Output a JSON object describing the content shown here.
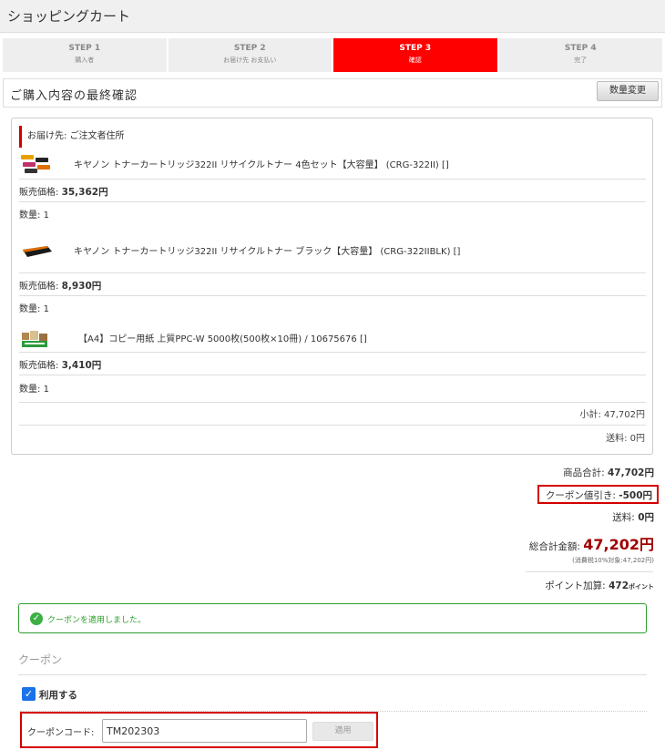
{
  "header": {
    "title": "ショッピングカート"
  },
  "steps": [
    {
      "num": "STEP 1",
      "label": "購入者"
    },
    {
      "num": "STEP 2",
      "label": "お届け先 お支払い"
    },
    {
      "num": "STEP 3",
      "label": "確認"
    },
    {
      "num": "STEP 4",
      "label": "完了"
    }
  ],
  "confirm": {
    "title": "ご購入内容の最終確認",
    "qty_button": "数量変更"
  },
  "cart": {
    "ship_to": "お届け先: ご注文者住所",
    "items": [
      {
        "name": "キヤノン トナーカートリッジ322II リサイクルトナー 4色セット【大容量】 (CRG-322II) []",
        "price_label": "販売価格:",
        "price": "35,362円",
        "qty_label": "数量:",
        "qty": "1",
        "image_icon": "toner-set-image"
      },
      {
        "name": "キヤノン トナーカートリッジ322II リサイクルトナー ブラック【大容量】 (CRG-322IIBLK) []",
        "price_label": "販売価格:",
        "price": "8,930円",
        "qty_label": "数量:",
        "qty": "1",
        "image_icon": "toner-black-image"
      },
      {
        "name": "【A4】コピー用紙 上質PPC-W 5000枚(500枚×10冊) / 10675676 []",
        "price_label": "販売価格:",
        "price": "3,410円",
        "qty_label": "数量:",
        "qty": "1",
        "image_icon": "copy-paper-image"
      }
    ],
    "subtotal": "小計: 47,702円",
    "shipping": "送料: 0円"
  },
  "summary": {
    "goods_total_label": "商品合計:",
    "goods_total": "47,702円",
    "coupon_discount_label": "クーポン値引き:",
    "coupon_discount": "-500円",
    "shipping_label": "送料:",
    "shipping": "0円",
    "grand_total_label": "総合計金額:",
    "grand_total": "47,202円",
    "tax_note": "(消費税10%対象:47,202円)",
    "points_label": "ポイント加算:",
    "points": "472",
    "points_unit": "ポイント"
  },
  "success": {
    "message": "クーポンを適用しました。"
  },
  "coupon": {
    "heading": "クーポン",
    "use_label": "利用する",
    "use_checked": true,
    "code_label": "クーポンコード:",
    "code_value": "TM202303",
    "apply_label": "適用"
  },
  "colors": {
    "accent": "#ff0000",
    "highlight": "#d40000",
    "success": "#2e9e2e",
    "checkbox": "#1a73e8",
    "grand_total": "#a00000"
  }
}
